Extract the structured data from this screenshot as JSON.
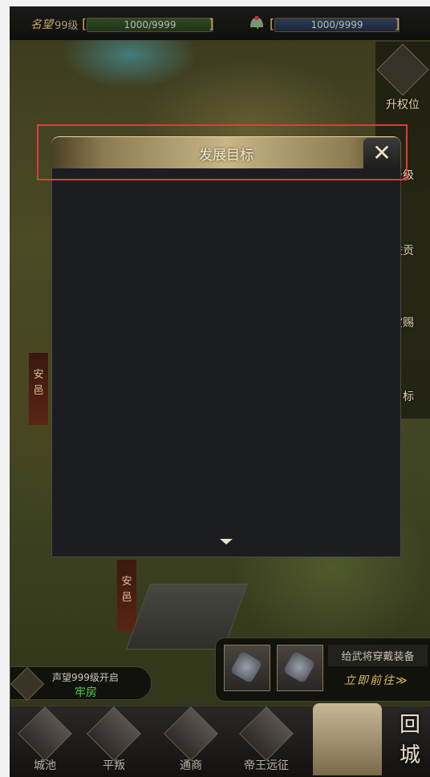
{
  "topbar": {
    "fame_label": "名望",
    "fame_level": "99级",
    "fame_bar_text": "1000/9999",
    "fame_bar_fill": 1.0,
    "troop_bar_text": "1000/9999",
    "troop_bar_fill": 1.0
  },
  "rail": {
    "items": [
      {
        "label": "升权位",
        "icon": "rank-up-icon"
      },
      {
        "label": "升级",
        "icon": "level-up-icon"
      },
      {
        "label": "进贡",
        "icon": "tribute-icon"
      },
      {
        "label": "赏赐",
        "icon": "reward-icon"
      },
      {
        "label": "目标",
        "icon": "goal-icon"
      }
    ]
  },
  "map": {
    "banner1": "安邑",
    "banner2": "安邑"
  },
  "modal": {
    "title": "发展目标",
    "close_symbol": "✕"
  },
  "lock_panel": {
    "text": "声望999级开启",
    "name": "牢房"
  },
  "equip_panel": {
    "hint": "给武将穿戴装备",
    "go_label": "立即前往≫"
  },
  "nav": {
    "items": [
      {
        "label": "城池",
        "icon": "city-icon"
      },
      {
        "label": "平叛",
        "icon": "suppress-icon"
      },
      {
        "label": "通商",
        "icon": "trade-icon"
      },
      {
        "label": "帝王远征",
        "icon": "expedition-icon"
      }
    ],
    "return_label": "回城"
  },
  "colors": {
    "highlight": "#e23a3a",
    "lock_green": "#4cd04c",
    "gold": "#c9a86a"
  }
}
